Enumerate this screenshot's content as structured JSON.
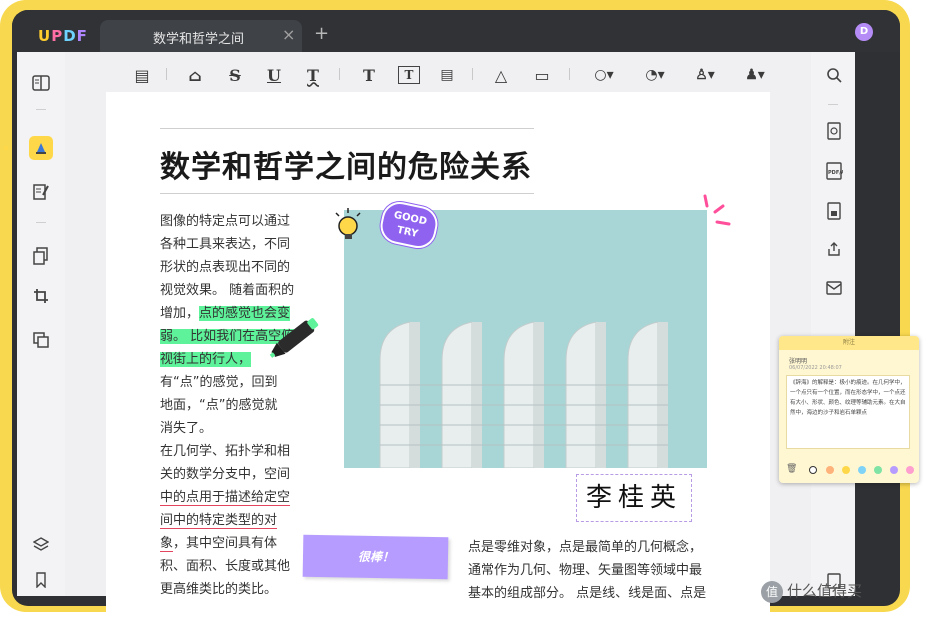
{
  "app": {
    "logo_part1": "U",
    "logo_part2": "P",
    "logo_part3": "D",
    "logo_part4": "F",
    "tab_title": "数学和哲学之间",
    "tab_close": "×",
    "new_tab": "+",
    "avatar_initial": "D"
  },
  "colors": {
    "frame": "#f8d84e",
    "accent": "#ffd84a",
    "highlight": "#5ef29a",
    "underline": "#e3455e",
    "sticky": "#b79cff"
  },
  "toolbar": {
    "tools": [
      {
        "icon": "comment-icon",
        "glyph": "▤"
      },
      {
        "icon": "highlighter-icon",
        "glyph": "⌂"
      },
      {
        "icon": "strikethrough-icon",
        "glyph": "S"
      },
      {
        "icon": "underline-icon",
        "glyph": "U"
      },
      {
        "icon": "squiggly-icon",
        "glyph": "T"
      },
      {
        "icon": "text-icon",
        "glyph": "T"
      },
      {
        "icon": "textbox-icon",
        "glyph": "T"
      },
      {
        "icon": "text-callout-icon",
        "glyph": "▤"
      },
      {
        "icon": "pencil-icon",
        "glyph": "△"
      },
      {
        "icon": "eraser-icon",
        "glyph": "▭"
      },
      {
        "icon": "shape-icon",
        "glyph": "○▾"
      },
      {
        "icon": "sticker-icon",
        "glyph": "◔▾"
      },
      {
        "icon": "stamp-icon",
        "glyph": "♙▾"
      },
      {
        "icon": "signature-icon",
        "glyph": "♟▾"
      }
    ]
  },
  "document": {
    "title": "数学和哲学之间的危险关系",
    "col1_lines": [
      "图像的特定点可以通过",
      "各种工具来表达，不同",
      "形状的点表现出不同的",
      "视觉效果。 随着面积的"
    ],
    "hl_prefix": "增加，",
    "hl_1": "点的感觉也会变",
    "hl_2": "弱。 比如我们在高空俯",
    "hl_3": "视街上的行人，",
    "col1_after": [
      "有“点”的感觉，回到",
      "地面，“点”的感觉就",
      "消失了。"
    ],
    "col1_para2_a": "在几何学、拓扑学和相",
    "col1_para2_b": "关的数学分支中，空间",
    "ul_1": "中的点用于描述给定空",
    "ul_2": "间中的特定类型的对",
    "ul_3": "象",
    "col1_para2_c": "，其中空间具有体",
    "col1_para2_d": "积、面积、长度或其他",
    "col1_para2_e": "更高维类比的类比。",
    "col2_lines": [
      "点是零维对象，点是最简单的几何概念，",
      "通常作为几何、物理、矢量图等领域中最",
      "基本的组成部分。 点是线、线是面、点是"
    ],
    "signature": "李桂英",
    "sticky_text": "很棒！",
    "sticker_good_try_1": "GOOD",
    "sticker_good_try_2": "TRY"
  },
  "note": {
    "header": "附注",
    "author": "张明明",
    "date": "06/07/2022 20:48:07",
    "text": "《辞海》的解释是：极小的痕迹。在几何学中，一个点只有一个位置，而在形态学中，一个点还有大小、形状、颜色、纹理等辅助元素。在大自然中，海边的沙子和岩石单颗点",
    "colors": [
      "#ffffff",
      "#ffb27a",
      "#ffd84a",
      "#7fd3f7",
      "#7ee3a4",
      "#b79cff",
      "#ff9fcf"
    ]
  },
  "watermark": {
    "logo": "值",
    "text": "什么值得买"
  }
}
